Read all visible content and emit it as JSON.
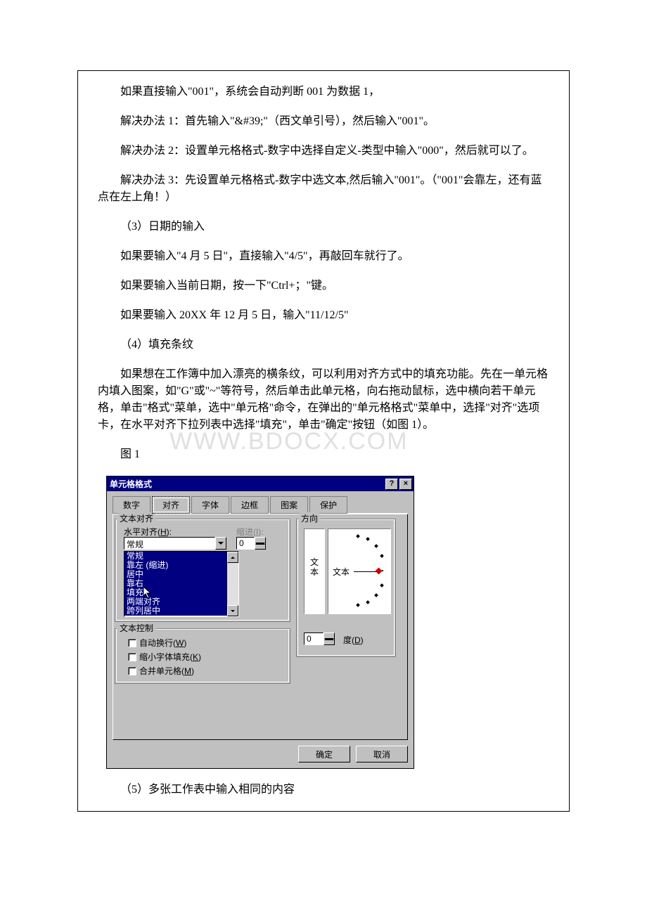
{
  "paragraphs": {
    "p1": "如果直接输入\"001\"，系统会自动判断 001 为数据 1，",
    "p2": "解决办法 1：首先输入\"&#39;\"（西文单引号），然后输入\"001\"。",
    "p3": "解决办法 2：设置单元格格式-数字中选择自定义-类型中输入\"000\"，然后就可以了。",
    "p4": "解决办法 3：先设置单元格格式-数字中选文本,然后输入\"001\"。（\"001\"会靠左，还有蓝点在左上角！）",
    "p5": "（3）日期的输入",
    "p6": "如果要输入\"4 月 5 日\"，直接输入\"4/5\"，再敲回车就行了。",
    "p7": "如果要输入当前日期，按一下\"Ctrl+；\"键。",
    "p8": "如果要输入 20XX 年 12 月 5 日，输入\"11/12/5\"",
    "p9": "（4）填充条纹",
    "p10": "如果想在工作簿中加入漂亮的横条纹，可以利用对齐方式中的填充功能。先在一单元格内填入图案，如\"G\"或\"~\"等符号，然后单击此单元格，向右拖动鼠标，选中横向若干单元格，单击\"格式\"菜单，选中\"单元格\"命令，在弹出的\"单元格格式\"菜单中，选择\"对齐\"选项卡，在水平对齐下拉列表中选择\"填充\"，单击\"确定\"按钮（如图 1）。",
    "p11": "图 1",
    "p12": "（5）多张工作表中输入相同的内容"
  },
  "watermark": "WWW.BDOCX.COM",
  "dialog": {
    "title": "单元格格式",
    "tabs": [
      "数字",
      "对齐",
      "字体",
      "边框",
      "图案",
      "保护"
    ],
    "active_tab": "对齐",
    "group_text_align": "文本对齐",
    "h_align_label": "水平对齐(H):",
    "h_combo_value": "常规",
    "indent_label": "缩进(I):",
    "indent_value": "0",
    "h_list": [
      "常规",
      "靠左 (缩进)",
      "居中",
      "靠右",
      "填充",
      "两端对齐",
      "跨列居中"
    ],
    "h_list_selected": "填充",
    "group_text_ctrl": "文本控制",
    "cb1": "自动换行(W)",
    "cb2": "缩小字体填充(K)",
    "cb3": "合并单元格(M)",
    "group_orient": "方向",
    "vtext": "文本",
    "dial_text": "文本",
    "degree_value": "0",
    "degree_label": "度(D)",
    "ok": "确定",
    "cancel": "取消"
  }
}
